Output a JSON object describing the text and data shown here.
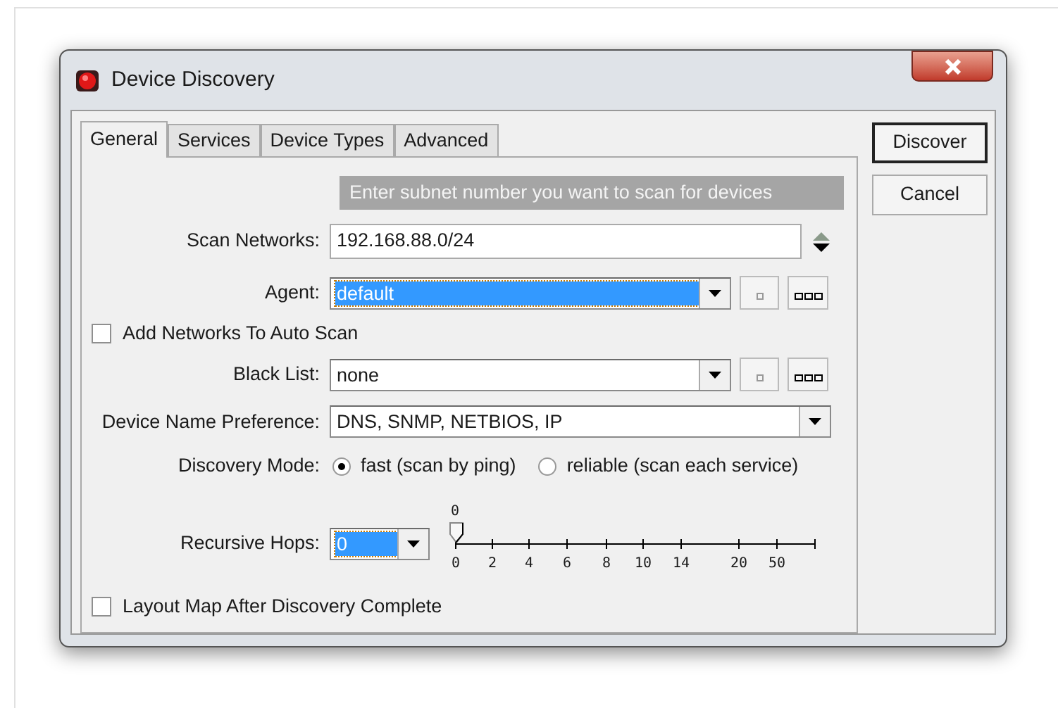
{
  "window": {
    "title": "Device Discovery"
  },
  "tabs": [
    {
      "label": "General",
      "selected": true
    },
    {
      "label": "Services",
      "selected": false
    },
    {
      "label": "Device Types",
      "selected": false
    },
    {
      "label": "Advanced",
      "selected": false
    }
  ],
  "hint": "Enter subnet number you want to scan for devices",
  "scan_networks": {
    "label": "Scan Networks:",
    "value": "192.168.88.0/24"
  },
  "agent": {
    "label": "Agent:",
    "value": "default",
    "selected": true
  },
  "add_networks": {
    "label": "Add Networks To Auto Scan",
    "checked": false
  },
  "black_list": {
    "label": "Black List:",
    "value": "none",
    "selected": false
  },
  "device_name_preference": {
    "label": "Device Name Preference:",
    "value": "DNS, SNMP, NETBIOS, IP"
  },
  "discovery_mode": {
    "label": "Discovery Mode:",
    "options": [
      {
        "label": "fast (scan by ping)",
        "selected": true
      },
      {
        "label": "reliable (scan each service)",
        "selected": false
      }
    ]
  },
  "recursive_hops": {
    "label": "Recursive Hops:",
    "value": "0",
    "selected": true,
    "slider": {
      "value_label": "0",
      "level": 0,
      "ticks": [
        "0",
        "2",
        "4",
        "6",
        "8",
        "10",
        "14",
        "20",
        "50"
      ]
    }
  },
  "layout_map": {
    "label": "Layout Map After Discovery Complete",
    "checked": false
  },
  "buttons": [
    "Discover",
    "Cancel"
  ]
}
